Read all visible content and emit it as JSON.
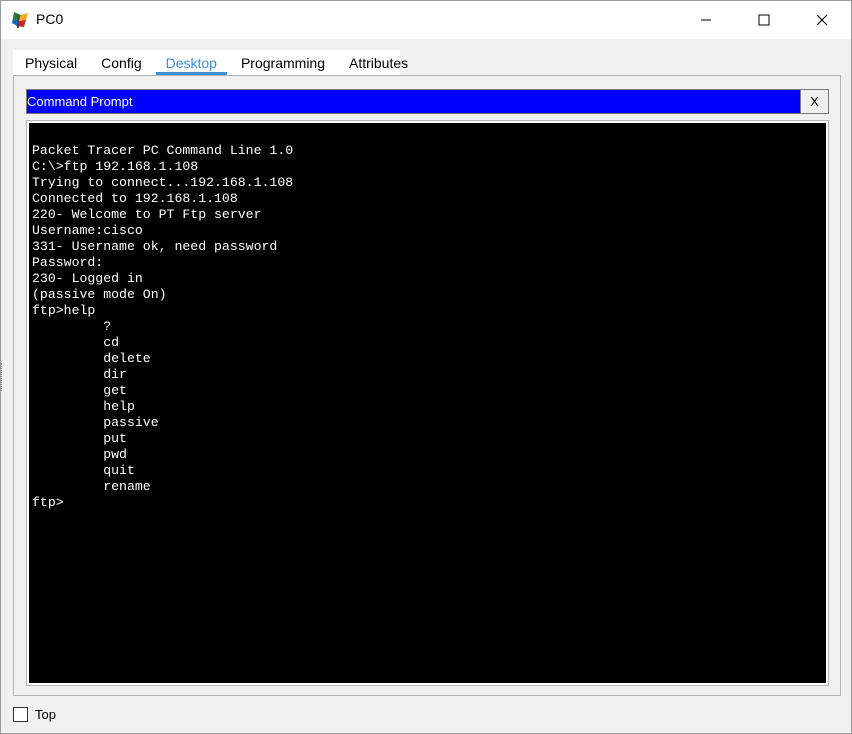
{
  "window": {
    "title": "PC0",
    "icon": "packet-tracer-pc-icon",
    "controls": {
      "minimize": "minimize-icon",
      "maximize": "maximize-icon",
      "close": "close-icon"
    }
  },
  "tabs": [
    {
      "label": "Physical",
      "active": false
    },
    {
      "label": "Config",
      "active": false
    },
    {
      "label": "Desktop",
      "active": true
    },
    {
      "label": "Programming",
      "active": false
    },
    {
      "label": "Attributes",
      "active": false
    }
  ],
  "command_prompt": {
    "title": "Command Prompt",
    "close_label": "X",
    "header_color": "#0000ff",
    "lines": [
      "Packet Tracer PC Command Line 1.0",
      "C:\\>ftp 192.168.1.108",
      "Trying to connect...192.168.1.108",
      "Connected to 192.168.1.108",
      "220- Welcome to PT Ftp server",
      "Username:cisco",
      "331- Username ok, need password",
      "Password:",
      "230- Logged in",
      "(passive mode On)",
      "ftp>help",
      "         ?",
      "         cd",
      "         delete",
      "         dir",
      "         get",
      "         help",
      "         passive",
      "         put",
      "         pwd",
      "         quit",
      "         rename",
      "ftp>"
    ]
  },
  "footer": {
    "top_checkbox_label": "Top",
    "top_checked": false
  },
  "colors": {
    "accent": "#3b8fd6",
    "terminal_bg": "#000000",
    "terminal_fg": "#ffffff"
  }
}
